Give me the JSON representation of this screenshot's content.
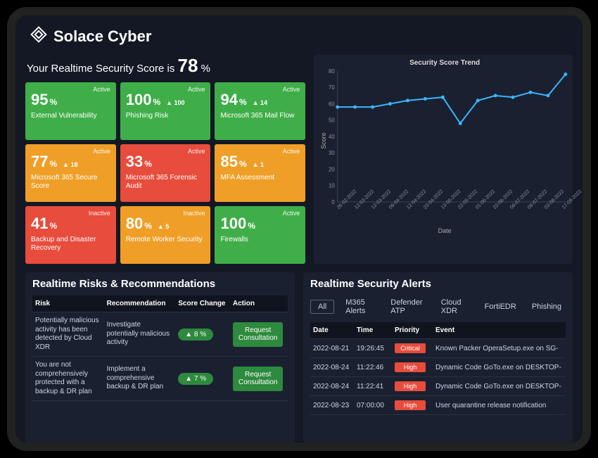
{
  "brand": "Solace Cyber",
  "score_heading_prefix": "Your Realtime Security Score is ",
  "score_value": "78",
  "score_suffix": " %",
  "tiles": [
    {
      "pct": "95",
      "label": "External Vulnerability",
      "status": "Active",
      "color": "c-green",
      "delta": ""
    },
    {
      "pct": "100",
      "label": "Phishing Risk",
      "status": "Active",
      "color": "c-green",
      "delta": "▲ 100"
    },
    {
      "pct": "94",
      "label": "Microsoft 365 Mail Flow",
      "status": "Active",
      "color": "c-green",
      "delta": "▲ 14"
    },
    {
      "pct": "77",
      "label": "Microsoft 365 Secure Score",
      "status": "Active",
      "color": "c-orange",
      "delta": "▲ 18"
    },
    {
      "pct": "33",
      "label": "Microsoft 365 Forensic Audit",
      "status": "Active",
      "color": "c-red",
      "delta": ""
    },
    {
      "pct": "85",
      "label": "MFA Assessment",
      "status": "Active",
      "color": "c-orange",
      "delta": "▲ 1"
    },
    {
      "pct": "41",
      "label": "Backup and Disaster Recovery",
      "status": "Inactive",
      "color": "c-red",
      "delta": ""
    },
    {
      "pct": "80",
      "label": "Remote Worker Security",
      "status": "Inactive",
      "color": "c-orange",
      "delta": "▲ 5"
    },
    {
      "pct": "100",
      "label": "Firewalls",
      "status": "Active",
      "color": "c-green",
      "delta": ""
    }
  ],
  "chart": {
    "title": "Security Score Trend",
    "ylabel": "Score",
    "xlabel": "Date"
  },
  "chart_data": {
    "type": "line",
    "title": "Security Score Trend",
    "xlabel": "Date",
    "ylabel": "Score",
    "ylim": [
      0,
      80
    ],
    "yticks": [
      0,
      10,
      20,
      30,
      40,
      50,
      60,
      70,
      80
    ],
    "categories": [
      "26-02-2022",
      "12-03-2022",
      "12-03-2022",
      "09-04-2022",
      "12-04-2022",
      "23-04-2022",
      "13-05-2022",
      "22-05-2022",
      "01-06-2022",
      "22-06-2022",
      "06-07-2022",
      "08-07-2022",
      "03-08-2022",
      "17-08-2022"
    ],
    "values": [
      58,
      58,
      58,
      60,
      62,
      63,
      64,
      48,
      62,
      65,
      64,
      67,
      65,
      78
    ]
  },
  "risks": {
    "title": "Realtime Risks & Recommendations",
    "columns": [
      "Risk",
      "Recommendation",
      "Score Change",
      "Action"
    ],
    "action_label": "Request Consultation",
    "rows": [
      {
        "risk": "Potentially malicious activity has been detected by Cloud XDR",
        "rec": "Investigate potentially malicious activity",
        "change": "▲ 8 %"
      },
      {
        "risk": "You are not comprehensively protected with a backup & DR plan",
        "rec": "Implement a comprehensive backup & DR plan",
        "change": "▲ 7 %"
      }
    ]
  },
  "alerts": {
    "title": "Realtime Security Alerts",
    "tabs": [
      "All",
      "M365 Alerts",
      "Defender ATP",
      "Cloud XDR",
      "FortiEDR",
      "Phishing"
    ],
    "active_tab": 0,
    "columns": [
      "Date",
      "Time",
      "Priority",
      "Event"
    ],
    "rows": [
      {
        "date": "2022-08-21",
        "time": "19:26:45",
        "priority": "Critical",
        "event": "Known Packer OperaSetup.exe on SG-"
      },
      {
        "date": "2022-08-24",
        "time": "11:22:46",
        "priority": "High",
        "event": "Dynamic Code GoTo.exe on DESKTOP-"
      },
      {
        "date": "2022-08-24",
        "time": "11:22:41",
        "priority": "High",
        "event": "Dynamic Code GoTo.exe on DESKTOP-"
      },
      {
        "date": "2022-08-23",
        "time": "07:00:00",
        "priority": "High",
        "event": "User quarantine release notification"
      }
    ]
  }
}
